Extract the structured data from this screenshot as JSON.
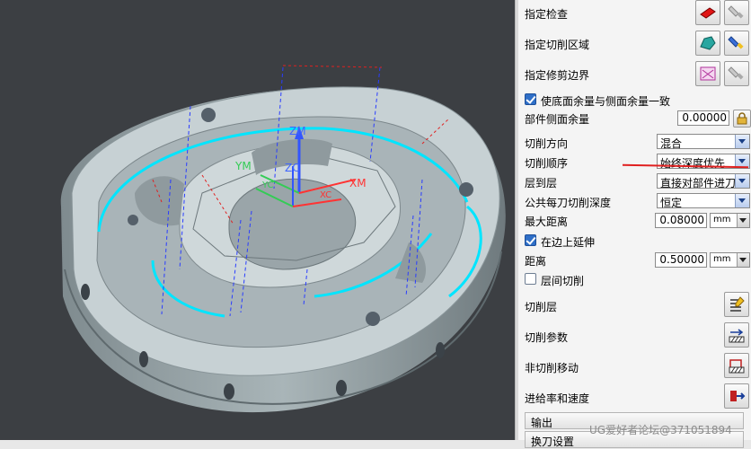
{
  "viewport": {
    "axes": {
      "zm": "ZM",
      "ym": "YM",
      "xm": "XM",
      "zc": "ZC",
      "yc": "YC",
      "xc": "XC"
    },
    "colors": {
      "background": "#3c3f43",
      "part": "#bcc8cc",
      "highlight": "#00e5ff",
      "toolpath": "#2a3dff",
      "mcs_x": "#ff3333",
      "mcs_y": "#33cc55",
      "mcs_z": "#3355ff"
    }
  },
  "panel": {
    "specify_check": {
      "label": "指定检查"
    },
    "specify_cut_area": {
      "label": "指定切削区域"
    },
    "specify_trim_boundary": {
      "label": "指定修剪边界"
    },
    "floor_wall_same": {
      "label": "使底面余量与侧面余量一致",
      "checked": true
    },
    "part_side_stock": {
      "label": "部件侧面余量",
      "value": "0.00000"
    },
    "cut_direction": {
      "label": "切削方向",
      "value": "混合"
    },
    "cut_order": {
      "label": "切削顺序",
      "value": "始终深度优先"
    },
    "cut_to_level": {
      "label": "层到层",
      "value": "直接对部件进刀"
    },
    "common_depth": {
      "label": "公共每刀切削深度",
      "value": "恒定"
    },
    "max_distance": {
      "label": "最大距离",
      "value": "0.08000",
      "unit": "mm"
    },
    "extend_at_edges": {
      "label": "在边上延伸",
      "checked": true
    },
    "distance": {
      "label": "距离",
      "value": "0.50000",
      "unit": "mm"
    },
    "between_levels": {
      "label": "层间切削",
      "checked": false
    },
    "cut_levels": {
      "label": "切削层"
    },
    "cut_params": {
      "label": "切削参数"
    },
    "non_cut_moves": {
      "label": "非切削移动"
    },
    "feeds_speeds": {
      "label": "进给率和速度"
    },
    "output_group": {
      "label": "输出"
    },
    "tool_group": {
      "label": "换刀设置"
    }
  },
  "watermark": "UG爱好者论坛@371051894"
}
